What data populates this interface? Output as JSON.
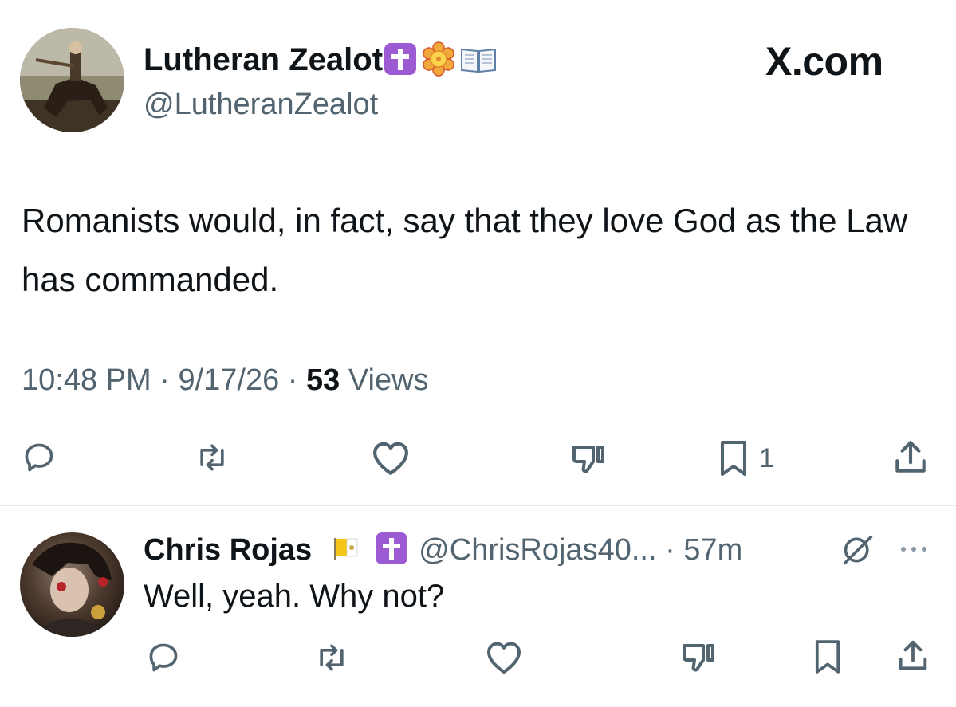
{
  "tweet": {
    "author_name": "Lutheran Zealot",
    "author_handle": "@LutheranZealot",
    "author_emojis": [
      "latin-cross-emoji",
      "rosette-emoji",
      "open-book-emoji"
    ],
    "text": "Romanists would, in fact, say that they love God as the Law has commanded.",
    "time": "10:48 PM",
    "separator": "·",
    "date": "9/17/26",
    "views_count": "53",
    "views_label": "Views",
    "actions": {
      "reply_icon": "reply-icon",
      "repost_icon": "repost-icon",
      "like_icon": "heart-icon",
      "dislike_icon": "thumbs-down-icon",
      "bookmark_icon": "bookmark-icon",
      "bookmark_count": "1",
      "share_icon": "share-icon"
    }
  },
  "watermark": "X.com",
  "reply": {
    "author_name": "Chris Rojas",
    "author_emojis": [
      "vatican-flag-emoji",
      "latin-cross-emoji"
    ],
    "author_handle": "@ChrisRojas40...",
    "separator": "·",
    "time_ago": "57m",
    "text": "Well, yeah. Why not?"
  },
  "colors": {
    "text_primary": "#0f1419",
    "text_secondary": "#536471",
    "divider": "#e3e7ea",
    "cross_badge": "#9c5bd3"
  }
}
